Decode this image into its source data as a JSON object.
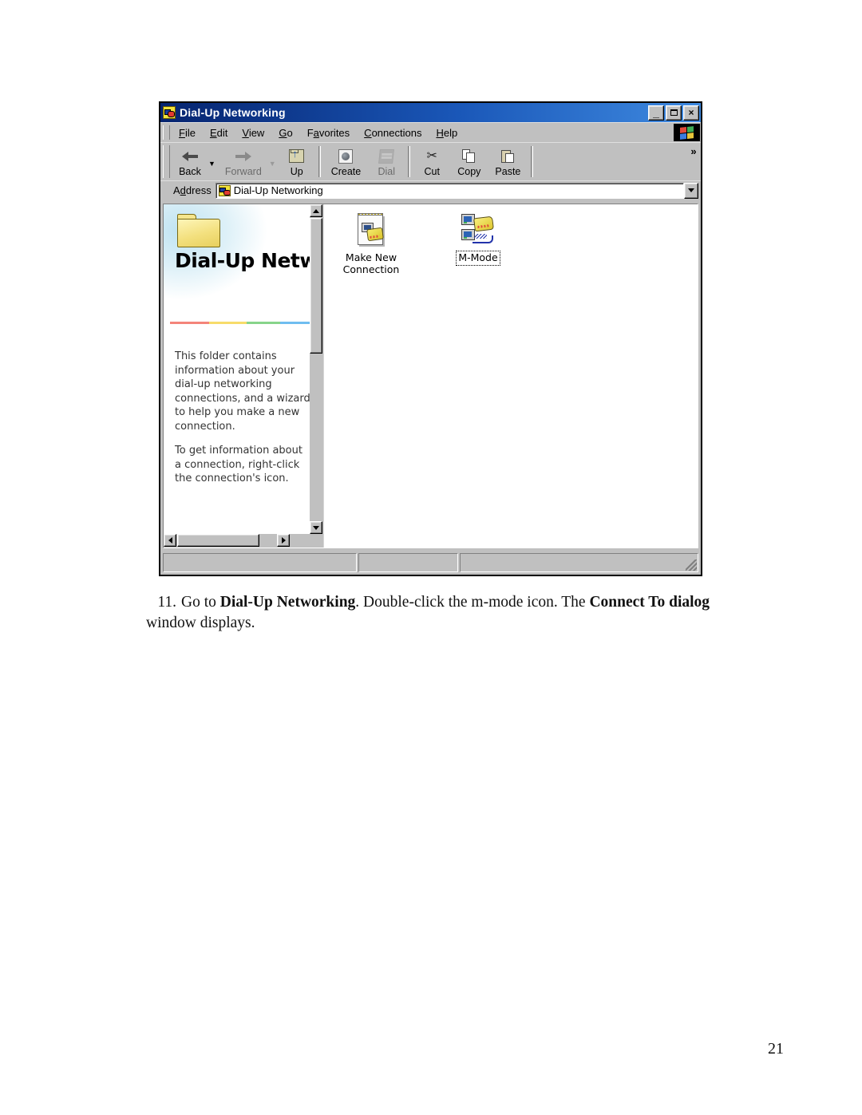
{
  "document": {
    "page_number": "21",
    "caption": {
      "number": "11.",
      "segments": [
        {
          "text": "Go to ",
          "bold": false
        },
        {
          "text": "Dial-Up Networking",
          "bold": true
        },
        {
          "text": ".  Double-click the m-mode icon.  The ",
          "bold": false
        },
        {
          "text": "Connect To dialog",
          "bold": true
        },
        {
          "text": " window displays.",
          "bold": false
        }
      ]
    }
  },
  "window": {
    "title": "Dial-Up Networking",
    "title_icon": "dial-up-networking-folder-icon",
    "controls": {
      "minimize": "_",
      "maximize": "□",
      "close": "×"
    },
    "menu": {
      "items": [
        {
          "label": "File",
          "accel": "F"
        },
        {
          "label": "Edit",
          "accel": "E"
        },
        {
          "label": "View",
          "accel": "V"
        },
        {
          "label": "Go",
          "accel": "G"
        },
        {
          "label": "Favorites",
          "accel": "a"
        },
        {
          "label": "Connections",
          "accel": "C"
        },
        {
          "label": "Help",
          "accel": "H"
        }
      ],
      "logo": "windows-flag-logo"
    },
    "toolbar": {
      "buttons": [
        {
          "label": "Back",
          "icon": "back-arrow-icon",
          "disabled": false,
          "has_dropdown": true
        },
        {
          "label": "Forward",
          "icon": "forward-arrow-icon",
          "disabled": true,
          "has_dropdown": true
        },
        {
          "label": "Up",
          "icon": "up-folder-icon",
          "disabled": false,
          "has_dropdown": false
        },
        {
          "label": "Create",
          "icon": "create-connection-icon",
          "disabled": false,
          "has_dropdown": false
        },
        {
          "label": "Dial",
          "icon": "dial-icon",
          "disabled": true,
          "has_dropdown": false
        },
        {
          "label": "Cut",
          "icon": "scissors-icon",
          "disabled": false,
          "has_dropdown": false
        },
        {
          "label": "Copy",
          "icon": "copy-icon",
          "disabled": false,
          "has_dropdown": false
        },
        {
          "label": "Paste",
          "icon": "paste-icon",
          "disabled": false,
          "has_dropdown": false
        }
      ],
      "overflow": "»"
    },
    "address": {
      "label": "Address",
      "accel": "d",
      "value": "Dial-Up Networking",
      "icon": "dial-up-networking-folder-icon",
      "dropdown": "chevron-down-icon"
    },
    "webview": {
      "folder_icon": "yellow-folder-icon",
      "heading": "Dial-Up Networkin",
      "rule_colors": [
        "#f4847a",
        "#f7dc6a",
        "#87d48a",
        "#6fbdf0"
      ],
      "paragraphs": [
        "This folder contains information about your dial-up networking connections, and a wizard to help you make a new connection.",
        "To get information about a connection, right-click the connection's icon."
      ]
    },
    "items": [
      {
        "label": "Make New Connection",
        "icon": "make-new-connection-wizard-icon",
        "selected": false
      },
      {
        "label": "M-Mode",
        "icon": "dial-up-connection-icon",
        "selected": true
      }
    ],
    "statusbar": {
      "panes": [
        "",
        "",
        ""
      ],
      "resize_grip": "resize-grip-icon"
    }
  }
}
